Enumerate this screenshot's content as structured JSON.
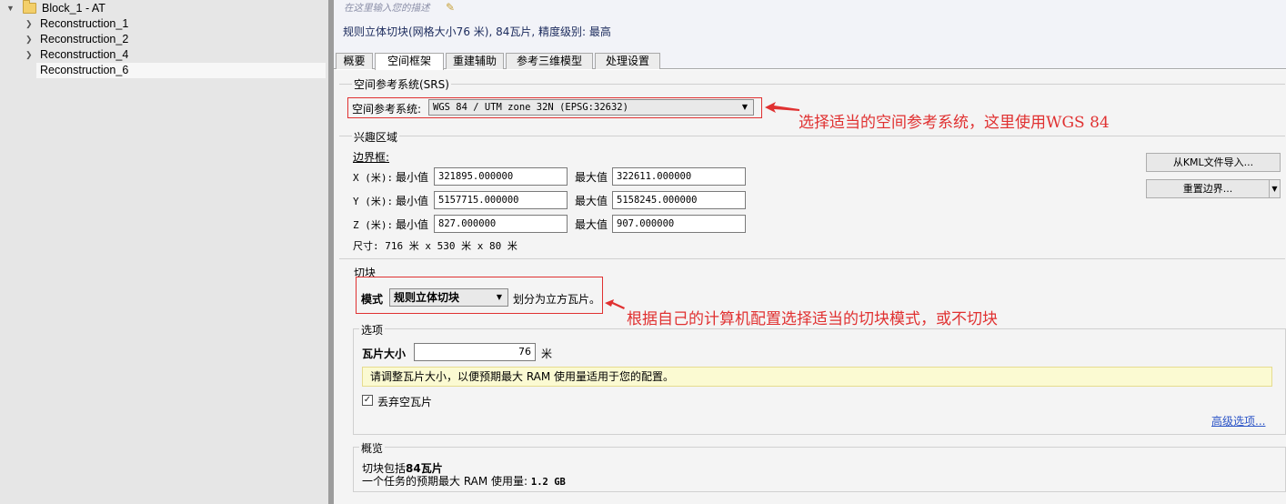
{
  "tree": {
    "root": {
      "label": "Block_1 - AT"
    },
    "items": [
      {
        "label": "Reconstruction_1"
      },
      {
        "label": "Reconstruction_2"
      },
      {
        "label": "Reconstruction_4"
      },
      {
        "label": "Reconstruction_6"
      }
    ]
  },
  "header": {
    "desc_placeholder": "在这里输入您的描述",
    "summary": "规则立体切块(网格大小76 米), 84瓦片, 精度级别: 最高"
  },
  "tabs": [
    {
      "label": "概要"
    },
    {
      "label": "空间框架"
    },
    {
      "label": "重建辅助"
    },
    {
      "label": "参考三维模型"
    },
    {
      "label": "处理设置"
    }
  ],
  "srs": {
    "group_title": "空间参考系统(SRS)",
    "label": "空间参考系统:",
    "value": "WGS 84 / UTM zone 32N (EPSG:32632)",
    "annotation": "选择适当的空间参考系统，这里使用WGS 84"
  },
  "roi": {
    "group_title": "兴趣区域",
    "bbox_label": "边界框:",
    "rows": [
      {
        "axis": "X (米):",
        "min_label": "最小值",
        "min": "321895.000000",
        "max_label": "最大值",
        "max": "322611.000000"
      },
      {
        "axis": "Y (米):",
        "min_label": "最小值",
        "min": "5157715.000000",
        "max_label": "最大值",
        "max": "5158245.000000"
      },
      {
        "axis": "Z (米):",
        "min_label": "最小值",
        "min": "827.000000",
        "max_label": "最大值",
        "max": "907.000000"
      }
    ],
    "size": "尺寸: 716 米 x 530 米 x 80 米",
    "import_kml_label": "从KML文件导入...",
    "reset_label": "重置边界..."
  },
  "tiling": {
    "group_title": "切块",
    "mode_label": "模式",
    "mode_value": "规则立体切块",
    "mode_desc": "划分为立方瓦片。",
    "annotation": "根据自己的计算机配置选择适当的切块模式，或不切块",
    "options": {
      "group_title": "选项",
      "tile_size_label": "瓦片大小",
      "tile_size_value": "76",
      "tile_size_unit": "米",
      "hint": "请调整瓦片大小，以便预期最大 RAM 使用量适用于您的配置。",
      "discard_empty_label": "丢弃空瓦片",
      "discard_empty_checked": true,
      "advanced_link": "高级选项..."
    },
    "overview": {
      "group_title": "概览",
      "line1_prefix": "切块包括",
      "line1_value": "84瓦片",
      "line2_prefix": "一个任务的预期最大 RAM 使用量: ",
      "line2_value": "1.2 GB"
    }
  },
  "colors": {
    "annotation": "#e03131",
    "link": "#2b54c7",
    "hint_bg": "#fbfad2"
  }
}
